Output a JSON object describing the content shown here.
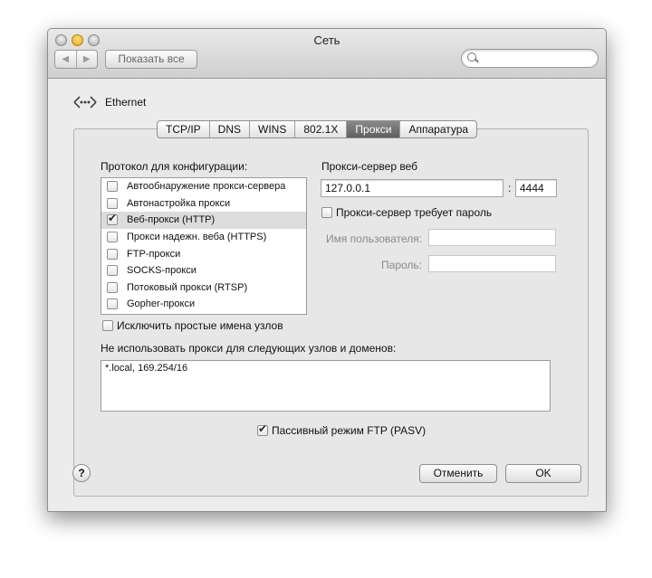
{
  "window": {
    "title": "Сеть"
  },
  "toolbar": {
    "back_icon": "chevron-left-icon",
    "forward_icon": "chevron-right-icon",
    "show_all_label": "Показать все",
    "search_value": ""
  },
  "interface": {
    "name": "Ethernet",
    "icon": "ethernet-icon"
  },
  "tabs": [
    {
      "label": "TCP/IP"
    },
    {
      "label": "DNS"
    },
    {
      "label": "WINS"
    },
    {
      "label": "802.1X"
    },
    {
      "label": "Прокси",
      "active": true
    },
    {
      "label": "Аппаратура"
    }
  ],
  "protocols": {
    "heading": "Протокол для конфигурации:",
    "items": [
      {
        "label": "Автообнаружение прокси-сервера",
        "checked": false
      },
      {
        "label": "Автонастройка прокси",
        "checked": false
      },
      {
        "label": "Веб-прокси (HTTP)",
        "checked": true,
        "selected": true
      },
      {
        "label": "Прокси надежн. веба (HTTPS)",
        "checked": false
      },
      {
        "label": "FTP-прокси",
        "checked": false
      },
      {
        "label": "SOCKS-прокси",
        "checked": false
      },
      {
        "label": "Потоковый прокси (RTSP)",
        "checked": false
      },
      {
        "label": "Gopher-прокси",
        "checked": false
      }
    ]
  },
  "proxy_server": {
    "heading": "Прокси-сервер веб",
    "host": "127.0.0.1",
    "separator": ":",
    "port": "4444",
    "requires_password_label": "Прокси-сервер требует пароль",
    "requires_password": false,
    "username_label": "Имя пользователя:",
    "username_value": "",
    "password_label": "Пароль:",
    "password_value": ""
  },
  "exclude_simple_label": "Исключить простые имена узлов",
  "bypass": {
    "heading": "Не использовать прокси для следующих узлов и доменов:",
    "value": "*.local, 169.254/16"
  },
  "pasv_label": "Пассивный режим FTP (PASV)",
  "pasv_checked": true,
  "buttons": {
    "help": "?",
    "cancel": "Отменить",
    "ok": "OK"
  }
}
